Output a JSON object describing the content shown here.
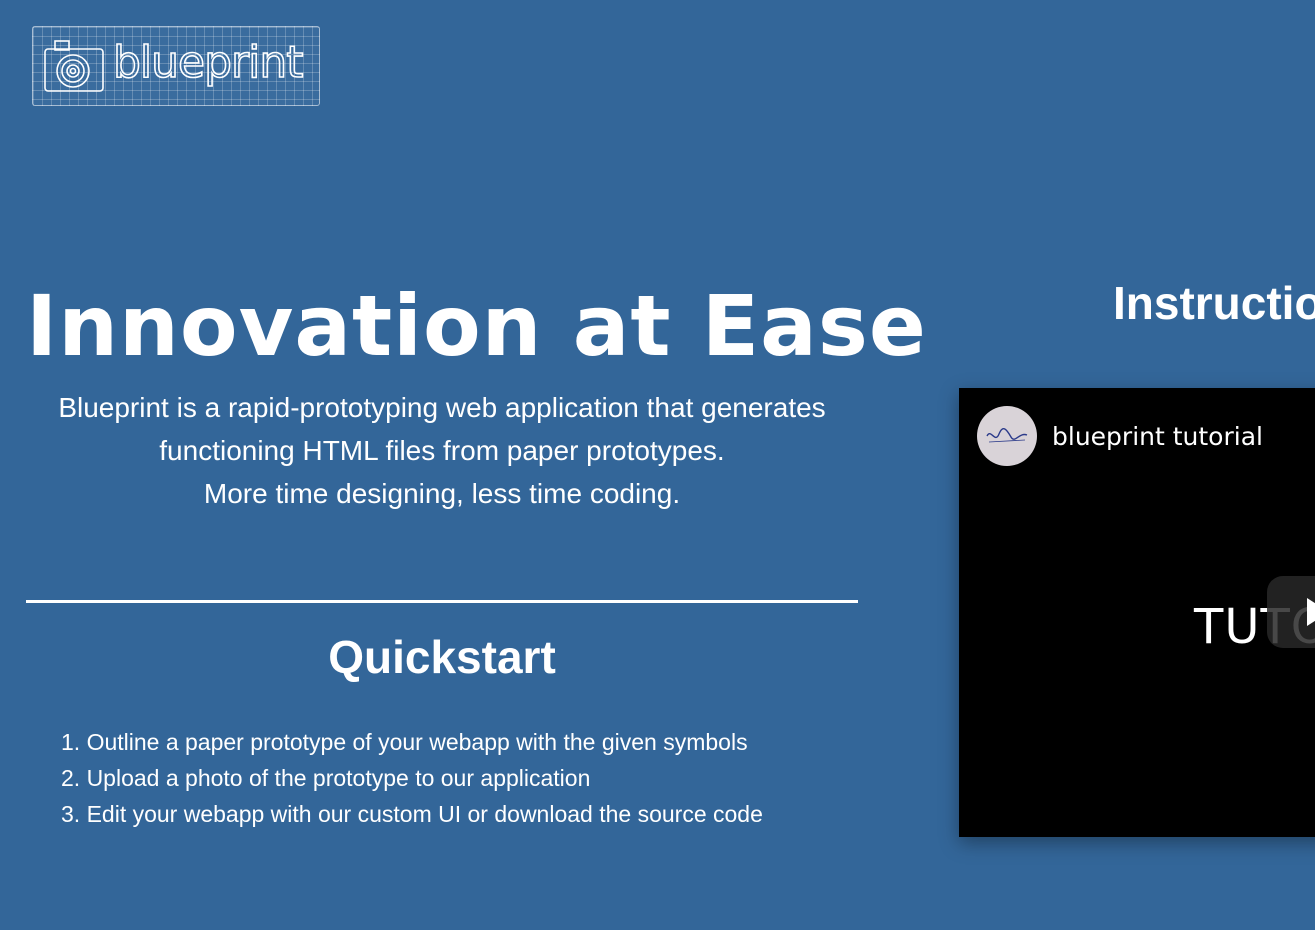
{
  "logo": {
    "text": "blueprint"
  },
  "hero": {
    "title": "Innovation at Ease",
    "description_lines": [
      "Blueprint is a rapid-prototyping web application that generates",
      "functioning HTML files from paper prototypes.",
      "More time designing, less time coding."
    ]
  },
  "quickstart": {
    "title": "Quickstart",
    "steps": [
      "1. Outline a paper prototype of your webapp with the given symbols",
      "2. Upload a photo of the prototype to our application",
      "3. Edit your webapp with our custom UI or download the source code"
    ]
  },
  "instructions": {
    "title": "Instructions",
    "video": {
      "title": "blueprint tutorial",
      "overlay_text": "TUTO",
      "channel_avatar_icon": "signature-avatar-icon",
      "play_icon": "play-icon"
    }
  },
  "colors": {
    "background": "#336699",
    "text": "#ffffff",
    "video_background": "#000000"
  }
}
